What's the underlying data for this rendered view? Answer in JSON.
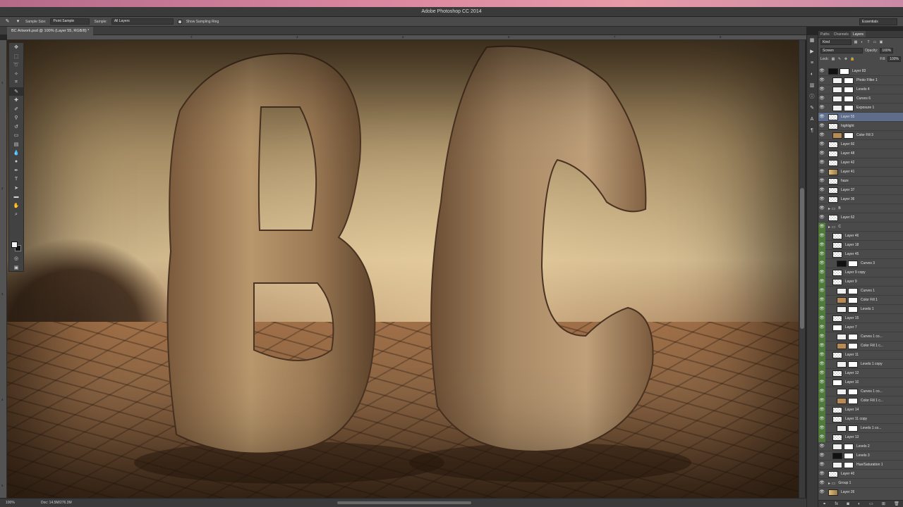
{
  "app": {
    "title": "Adobe Photoshop CC 2014"
  },
  "options": {
    "sample_size_label": "Sample Size:",
    "sample_size_value": "Point Sample",
    "sample_label": "Sample:",
    "sample_value": "All Layers",
    "show_ring_label": "Show Sampling Ring",
    "workspace": "Essentials"
  },
  "document": {
    "tab": "BC Artwork.psd @ 100% (Layer 55, RGB/8) *"
  },
  "rulers": {
    "top": [
      "3",
      "4",
      "5",
      "6",
      "7",
      "8"
    ],
    "left": [
      "1",
      "2",
      "3",
      "4",
      "5"
    ]
  },
  "status": {
    "zoom": "100%",
    "doc": "Doc: 14.5M/276.3M"
  },
  "panel": {
    "tabs": [
      "Paths",
      "Channels",
      "Layers"
    ],
    "kind": "Kind",
    "blend": "Screen",
    "opacity_label": "Opacity:",
    "opacity_value": "100%",
    "lock_label": "Lock:",
    "fill_label": "Fill:",
    "fill_value": "100%"
  },
  "layers": [
    {
      "name": "Layer 83",
      "thumb": "black",
      "green": false,
      "selected": false,
      "indent": 0
    },
    {
      "name": "Photo Filter 1",
      "thumb": "adj",
      "green": false,
      "selected": false,
      "indent": 1
    },
    {
      "name": "Levels 4",
      "thumb": "adj",
      "green": false,
      "selected": false,
      "indent": 1
    },
    {
      "name": "Curves 6",
      "thumb": "adj",
      "green": false,
      "selected": false,
      "indent": 1
    },
    {
      "name": "Exposure 1",
      "thumb": "adj",
      "green": false,
      "selected": false,
      "indent": 1
    },
    {
      "name": "Layer 55",
      "thumb": "trans",
      "green": false,
      "selected": true,
      "indent": 0
    },
    {
      "name": "highlight",
      "thumb": "trans",
      "green": false,
      "selected": false,
      "indent": 0
    },
    {
      "name": "Color Fill 3",
      "thumb": "fill",
      "green": false,
      "selected": false,
      "indent": 1
    },
    {
      "name": "Layer 60",
      "thumb": "trans",
      "green": false,
      "selected": false,
      "indent": 0
    },
    {
      "name": "Layer 48",
      "thumb": "trans",
      "green": false,
      "selected": false,
      "indent": 0
    },
    {
      "name": "Layer 42",
      "thumb": "trans",
      "green": false,
      "selected": false,
      "indent": 0
    },
    {
      "name": "Layer 41",
      "thumb": "img",
      "green": false,
      "selected": false,
      "indent": 0
    },
    {
      "name": "haze",
      "thumb": "trans",
      "green": false,
      "selected": false,
      "indent": 0
    },
    {
      "name": "Layer 37",
      "thumb": "trans",
      "green": false,
      "selected": false,
      "indent": 0
    },
    {
      "name": "Layer 36",
      "thumb": "trans",
      "green": false,
      "selected": false,
      "indent": 0
    },
    {
      "name": "B",
      "thumb": "folder",
      "green": false,
      "selected": false,
      "indent": 0
    },
    {
      "name": "Layer 62",
      "thumb": "trans",
      "green": false,
      "selected": false,
      "indent": 0
    },
    {
      "name": "C",
      "thumb": "folder",
      "green": true,
      "selected": false,
      "indent": 0
    },
    {
      "name": "Layer 46",
      "thumb": "trans",
      "green": true,
      "selected": false,
      "indent": 1
    },
    {
      "name": "Layer 18",
      "thumb": "trans",
      "green": true,
      "selected": false,
      "indent": 1
    },
    {
      "name": "Layer 45",
      "thumb": "trans",
      "green": true,
      "selected": false,
      "indent": 1
    },
    {
      "name": "Curves 3",
      "thumb": "black",
      "green": true,
      "selected": false,
      "indent": 2
    },
    {
      "name": "Layer 9 copy",
      "thumb": "trans",
      "green": true,
      "selected": false,
      "indent": 1
    },
    {
      "name": "Layer 9",
      "thumb": "trans",
      "green": true,
      "selected": false,
      "indent": 1
    },
    {
      "name": "Curves 1",
      "thumb": "adj",
      "green": true,
      "selected": false,
      "indent": 2
    },
    {
      "name": "Color Fill 1",
      "thumb": "fill",
      "green": true,
      "selected": false,
      "indent": 2
    },
    {
      "name": "Levels 1",
      "thumb": "adj",
      "green": true,
      "selected": false,
      "indent": 2
    },
    {
      "name": "Layer 15",
      "thumb": "trans",
      "green": true,
      "selected": false,
      "indent": 1
    },
    {
      "name": "Layer 7",
      "thumb": "mask",
      "green": true,
      "selected": false,
      "indent": 1
    },
    {
      "name": "Curves 1 co...",
      "thumb": "adj",
      "green": true,
      "selected": false,
      "indent": 2
    },
    {
      "name": "Color Fill 1 c...",
      "thumb": "fill",
      "green": true,
      "selected": false,
      "indent": 2
    },
    {
      "name": "Layer 11",
      "thumb": "trans",
      "green": true,
      "selected": false,
      "indent": 1
    },
    {
      "name": "Levels 1 copy",
      "thumb": "adj",
      "green": true,
      "selected": false,
      "indent": 2
    },
    {
      "name": "Layer 12",
      "thumb": "trans",
      "green": true,
      "selected": false,
      "indent": 1
    },
    {
      "name": "Layer 10",
      "thumb": "mask",
      "green": true,
      "selected": false,
      "indent": 1
    },
    {
      "name": "Curves 1 co...",
      "thumb": "adj",
      "green": true,
      "selected": false,
      "indent": 2
    },
    {
      "name": "Color Fill 1 c...",
      "thumb": "fill",
      "green": true,
      "selected": false,
      "indent": 2
    },
    {
      "name": "Layer 14",
      "thumb": "trans",
      "green": true,
      "selected": false,
      "indent": 1
    },
    {
      "name": "Layer 11 copy",
      "thumb": "trans",
      "green": true,
      "selected": false,
      "indent": 1
    },
    {
      "name": "Levels 1 co...",
      "thumb": "adj",
      "green": true,
      "selected": false,
      "indent": 2
    },
    {
      "name": "Layer 13",
      "thumb": "trans",
      "green": true,
      "selected": false,
      "indent": 1
    },
    {
      "name": "Levels 2",
      "thumb": "adj",
      "green": false,
      "selected": false,
      "indent": 1
    },
    {
      "name": "Levels 3",
      "thumb": "black",
      "green": false,
      "selected": false,
      "indent": 1
    },
    {
      "name": "Hue/Saturation 1",
      "thumb": "adj",
      "green": false,
      "selected": false,
      "indent": 1
    },
    {
      "name": "Layer 40",
      "thumb": "trans",
      "green": false,
      "selected": false,
      "indent": 0
    },
    {
      "name": "Group 1",
      "thumb": "folder",
      "green": false,
      "selected": false,
      "indent": 0
    },
    {
      "name": "Layer 26",
      "thumb": "img",
      "green": false,
      "selected": false,
      "indent": 0
    }
  ]
}
